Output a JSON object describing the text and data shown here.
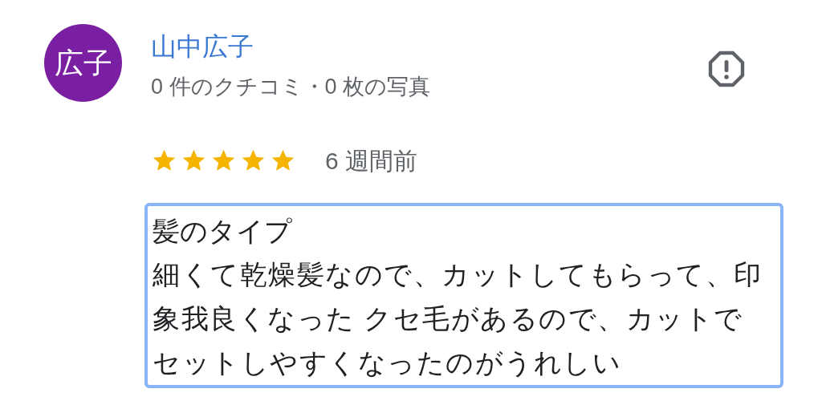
{
  "reviewer": {
    "avatar": "広子",
    "name": "山中広子",
    "stats": "0 件のクチコミ・0 枚の写真"
  },
  "review": {
    "stars": 5,
    "time": "6 週間前",
    "heading": "髪のタイプ",
    "body": "細くて乾燥髪なので、カットしてもらって、印象我良くなった クセ毛があるので、カットでセットしやすくなったのがうれしい",
    "highlighted": true
  }
}
